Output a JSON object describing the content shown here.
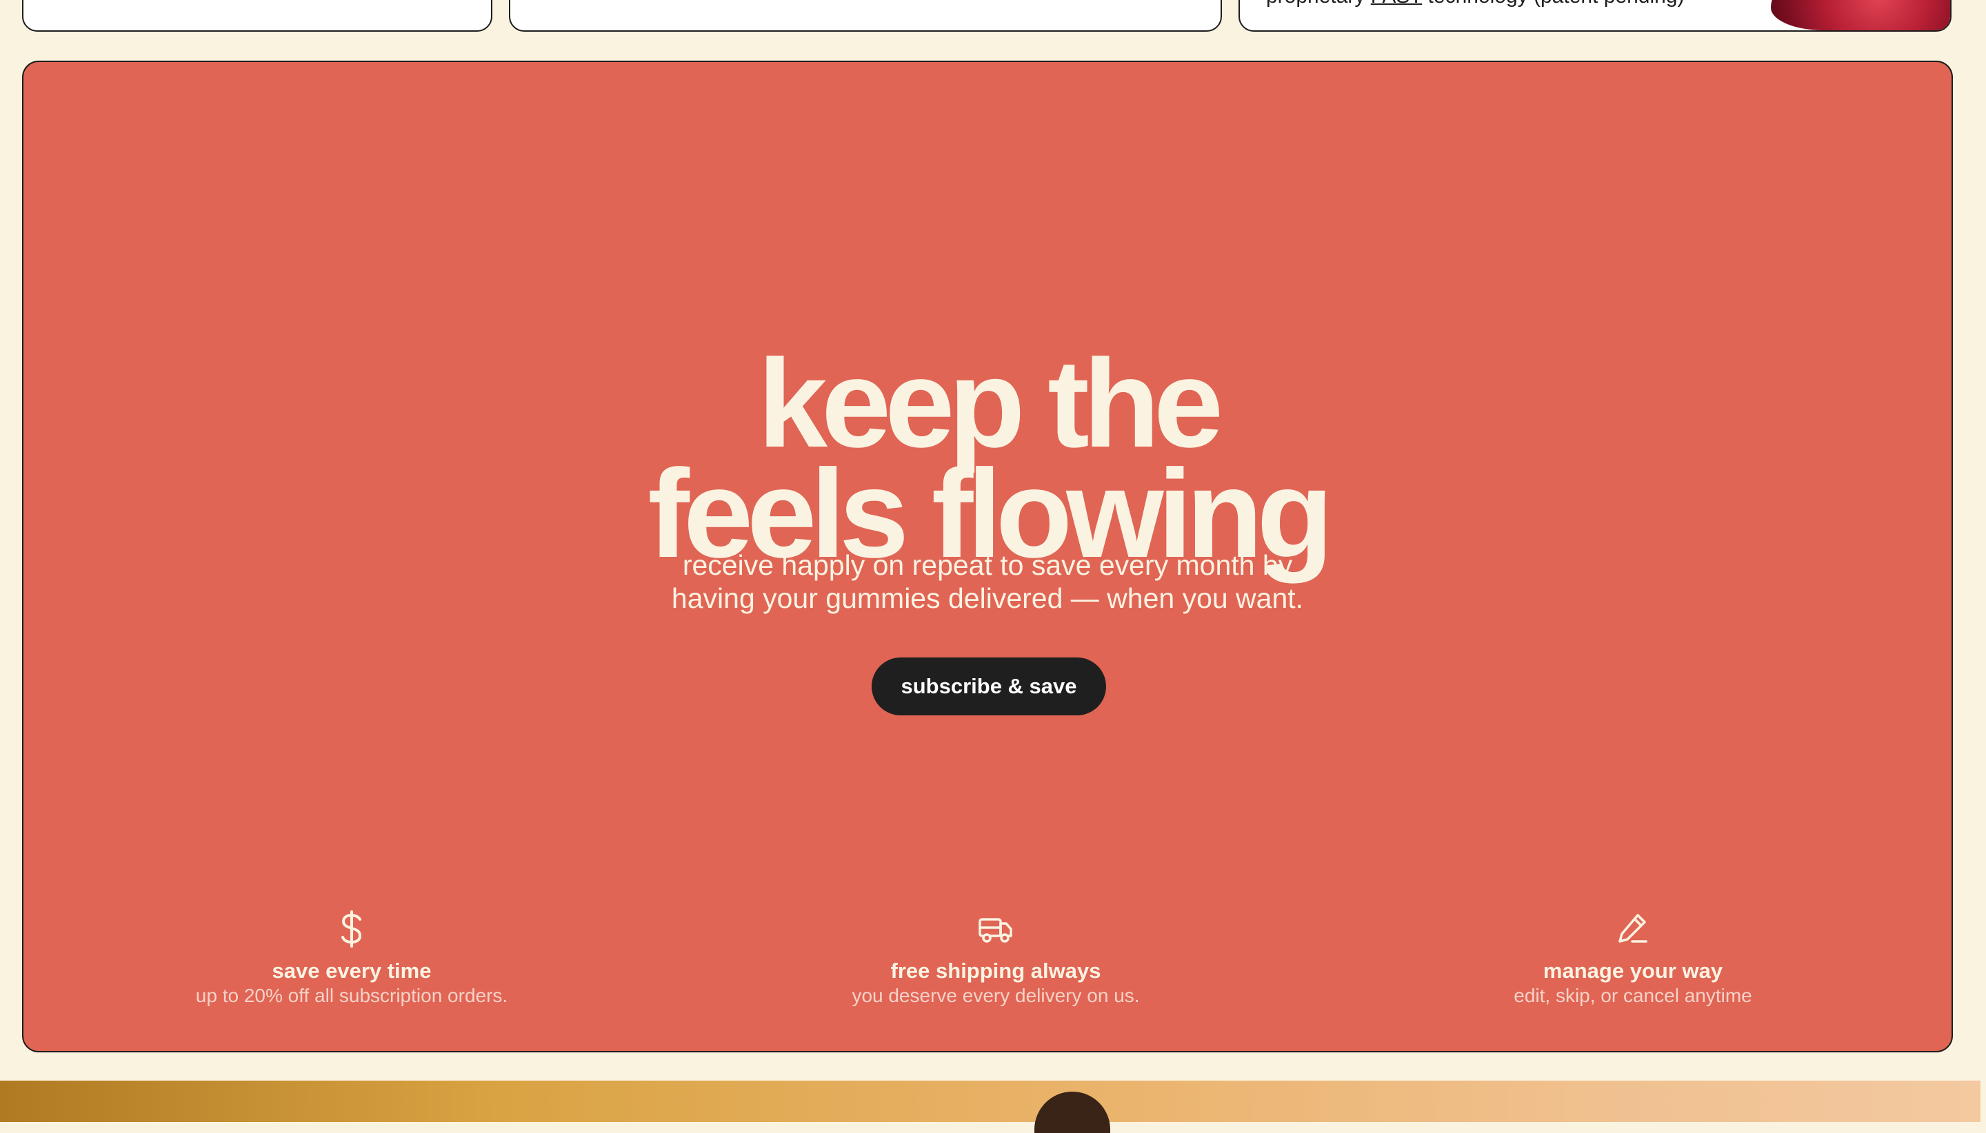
{
  "top_cards": {
    "card3_text_before": "proprietary ",
    "card3_link": "FAST",
    "card3_text_after": " technology (patent pending)"
  },
  "promo": {
    "headline_line1": "keep the",
    "headline_line2": "feels flowing",
    "subtext_line1": "receive happly on repeat to save every month by",
    "subtext_line2": "having your gummies delivered — when you want.",
    "cta_label": "subscribe & save",
    "features": [
      {
        "icon": "dollar-icon",
        "title": "save every time",
        "description": "up to 20% off all subscription orders."
      },
      {
        "icon": "truck-icon",
        "title": "free shipping always",
        "description": "you deserve every delivery on us."
      },
      {
        "icon": "pencil-icon",
        "title": "manage your way",
        "description": "edit, skip, or cancel anytime"
      }
    ]
  },
  "colors": {
    "page_background": "#faf3e0",
    "panel_background": "#e06555",
    "text_light": "#fbf3e2",
    "button_dark": "#1f1f1f"
  }
}
